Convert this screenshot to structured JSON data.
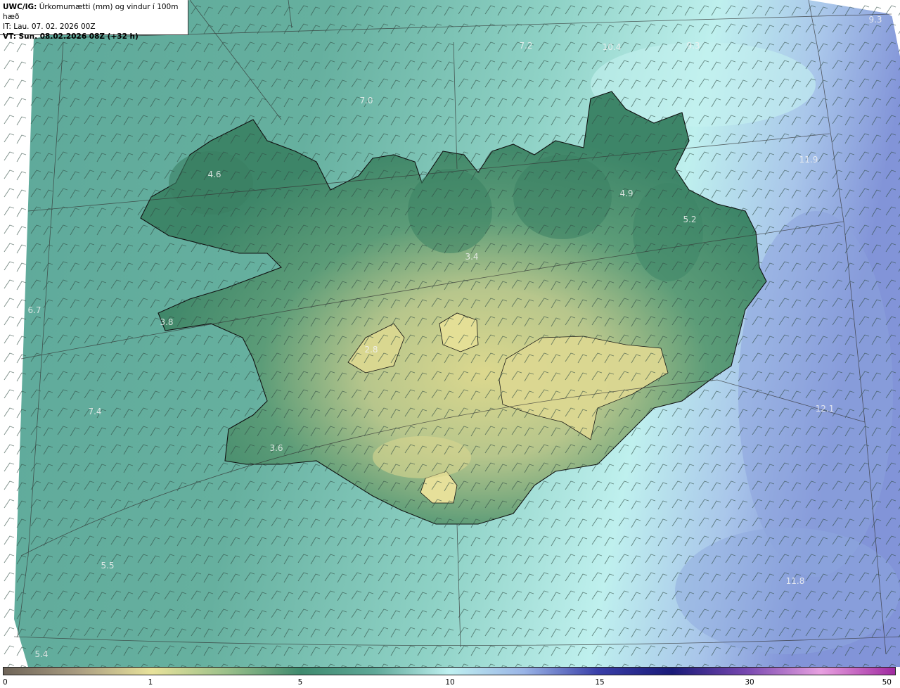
{
  "header": {
    "model": "UWC/IG:",
    "title": "Úrkomumætti (mm) og vindur í 100m hæð",
    "issue_time": "IT: Lau. 07. 02. 2026 00Z",
    "valid_time": "VT: Sun. 08.02.2026 08Z (+32 h)"
  },
  "map_labels": [
    {
      "text": "9.3"
    },
    {
      "text": "7.2"
    },
    {
      "text": "10.4"
    },
    {
      "text": "9.3"
    },
    {
      "text": "7.0"
    },
    {
      "text": "11.9"
    },
    {
      "text": "4.6"
    },
    {
      "text": "4.9"
    },
    {
      "text": "5.2"
    },
    {
      "text": "3.4"
    },
    {
      "text": "6.7"
    },
    {
      "text": "3.8"
    },
    {
      "text": "2.8"
    },
    {
      "text": "7.4"
    },
    {
      "text": "12.1"
    },
    {
      "text": "3.6"
    },
    {
      "text": "5.5"
    },
    {
      "text": "11.8"
    },
    {
      "text": "5.4"
    }
  ],
  "colorbar": {
    "ticks": [
      "0",
      "1",
      "5",
      "10",
      "15",
      "30",
      "50"
    ],
    "stops": [
      "#6e6458",
      "#a99c80",
      "#e8e29a",
      "#9bc08a",
      "#3f8a6e",
      "#5fa898",
      "#bff0f0",
      "#9ab4e6",
      "#3a3fa8",
      "#1a1a78",
      "#7848b0",
      "#e8a0e0",
      "#a02aa0"
    ]
  },
  "colors": {
    "land_low": "#e2dc92",
    "land_mid": "#78a878",
    "land_dark": "#3e8668",
    "sea": "#6cb3a4",
    "sea_light": "#b8eeee",
    "sea_blue": "#8ea6de"
  }
}
